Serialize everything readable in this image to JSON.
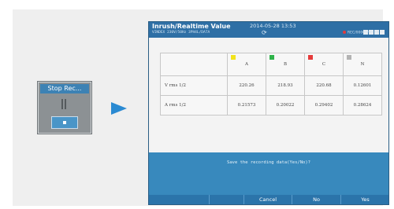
{
  "stop_panel": {
    "title": "Stop Rec..."
  },
  "device": {
    "title": "Inrush/Realtime Value",
    "datetime": "2014-05-28 13:53",
    "subheader": "VINDEX    230V/50Hz  3PH4L/DATA",
    "record_status": "REC/00000/00:33",
    "table": {
      "headers": [
        "A",
        "B",
        "C",
        "N"
      ],
      "header_colors": [
        "#f2e31b",
        "#2fb34a",
        "#e53b3b",
        "#b3b3b3"
      ],
      "rows": [
        {
          "label": "V rms 1/2",
          "values": [
            "220.26",
            "218.93",
            "220.68",
            "0.12601"
          ]
        },
        {
          "label": "A rms 1/2",
          "values": [
            "0.21573",
            "0.20022",
            "0.29402",
            "0.28624"
          ]
        }
      ]
    },
    "prompt": "Save the recording data(Yes/No)?",
    "buttons": {
      "cancel": "Cancel",
      "no": "No",
      "yes": "Yes"
    }
  }
}
